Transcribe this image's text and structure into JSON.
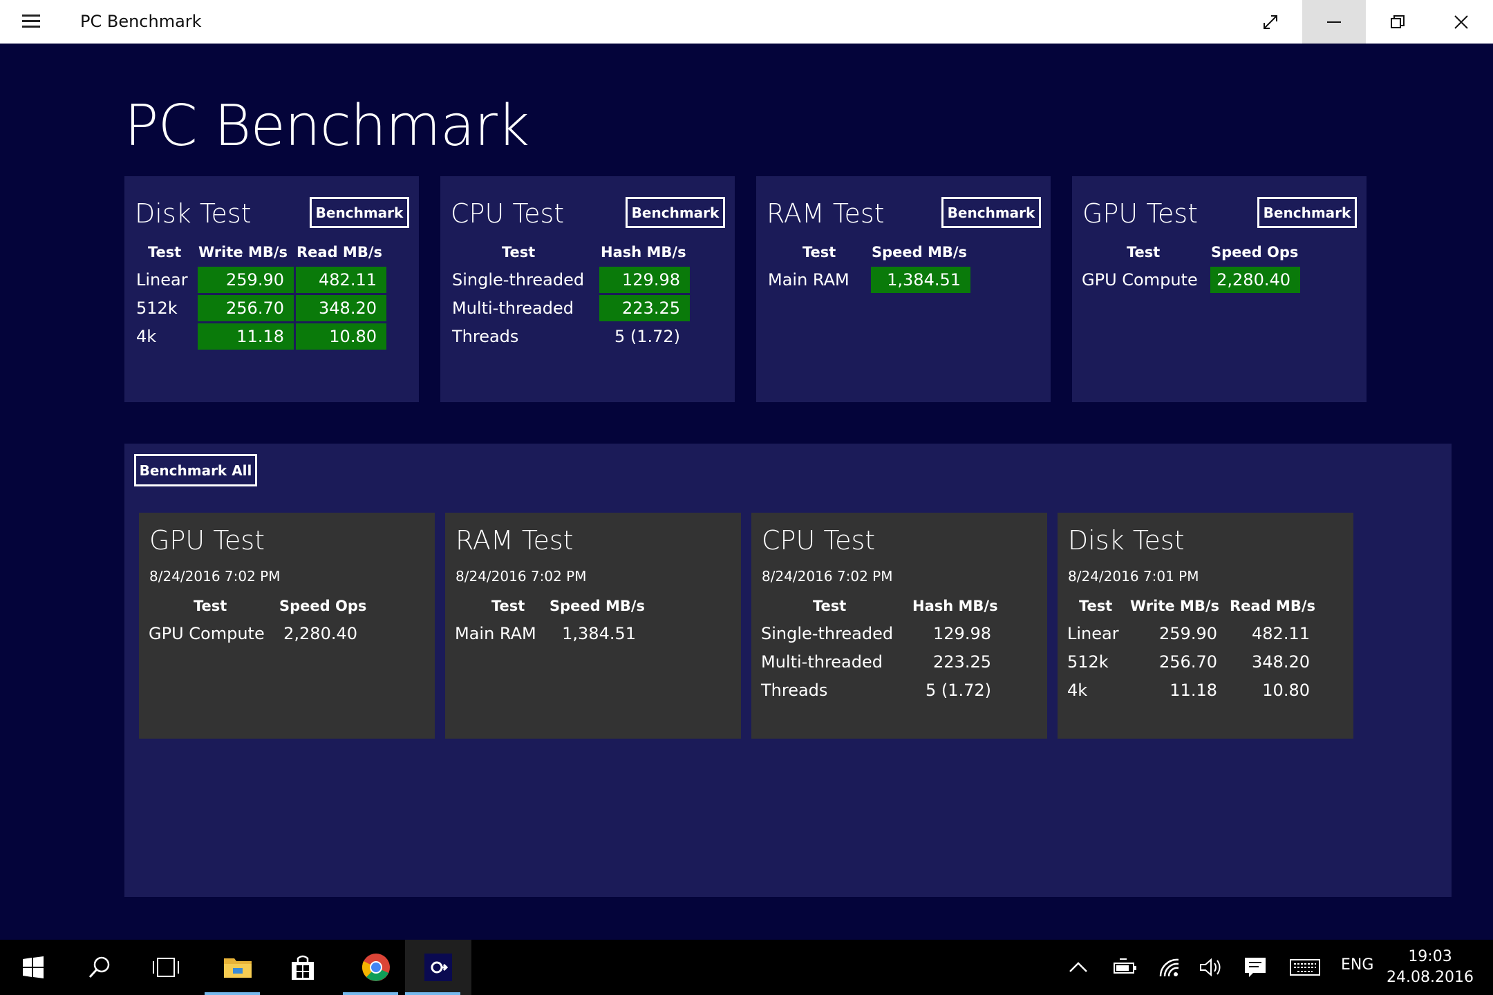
{
  "window": {
    "title": "PC Benchmark"
  },
  "page": {
    "heading": "PC Benchmark"
  },
  "cards": [
    {
      "title": "Disk Test",
      "button": "Benchmark",
      "headers": [
        "Test",
        "Write MB/s",
        "Read MB/s"
      ],
      "rows": [
        [
          "Linear",
          "259.90",
          "482.11"
        ],
        [
          "512k",
          "256.70",
          "348.20"
        ],
        [
          "4k",
          "11.18",
          "10.80"
        ]
      ]
    },
    {
      "title": "CPU Test",
      "button": "Benchmark",
      "headers": [
        "Test",
        "Hash MB/s"
      ],
      "rows": [
        [
          "Single-threaded",
          "129.98"
        ],
        [
          "Multi-threaded",
          "223.25"
        ],
        [
          "Threads",
          "5 (1.72)"
        ]
      ]
    },
    {
      "title": "RAM Test",
      "button": "Benchmark",
      "headers": [
        "Test",
        "Speed MB/s"
      ],
      "rows": [
        [
          "Main RAM",
          "1,384.51"
        ]
      ]
    },
    {
      "title": "GPU Test",
      "button": "Benchmark",
      "headers": [
        "Test",
        "Speed Ops"
      ],
      "rows": [
        [
          "GPU Compute",
          "2,280.40"
        ]
      ]
    }
  ],
  "results": {
    "benchmark_all": "Benchmark All",
    "items": [
      {
        "title": "GPU Test",
        "date": "8/24/2016 7:02 PM",
        "headers": [
          "Test",
          "Speed Ops"
        ],
        "rows": [
          [
            "GPU Compute",
            "2,280.40"
          ]
        ]
      },
      {
        "title": "RAM Test",
        "date": "8/24/2016 7:02 PM",
        "headers": [
          "Test",
          "Speed MB/s"
        ],
        "rows": [
          [
            "Main RAM",
            "1,384.51"
          ]
        ]
      },
      {
        "title": "CPU Test",
        "date": "8/24/2016 7:02 PM",
        "headers": [
          "Test",
          "Hash MB/s"
        ],
        "rows": [
          [
            "Single-threaded",
            "129.98"
          ],
          [
            "Multi-threaded",
            "223.25"
          ],
          [
            "Threads",
            "5 (1.72)"
          ]
        ]
      },
      {
        "title": "Disk Test",
        "date": "8/24/2016 7:01 PM",
        "headers": [
          "Test",
          "Write MB/s",
          "Read MB/s"
        ],
        "rows": [
          [
            "Linear",
            "259.90",
            "482.11"
          ],
          [
            "512k",
            "256.70",
            "348.20"
          ],
          [
            "4k",
            "11.18",
            "10.80"
          ]
        ]
      }
    ]
  },
  "taskbar": {
    "apps": [
      "start-icon",
      "search-icon",
      "task-view-icon",
      "file-explorer-icon",
      "store-icon",
      "chrome-icon",
      "pc-benchmark-icon"
    ],
    "tray": [
      "chevron-up-icon",
      "battery-icon",
      "wifi-icon",
      "volume-icon",
      "notifications-icon",
      "keyboard-icon"
    ],
    "language": "ENG",
    "time": "19:03",
    "date": "24.08.2016"
  },
  "colors": {
    "background": "#04043a",
    "card": "#1b1b58",
    "result_card": "#333333",
    "green_value": "#0a7a0a"
  }
}
